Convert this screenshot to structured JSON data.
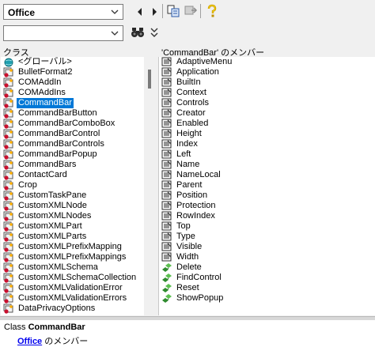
{
  "toolbar1": {
    "library_value": "Office",
    "buttons": [
      "back-icon",
      "forward-icon",
      "copy-to-clipboard-icon",
      "view-definition-icon",
      "help-icon"
    ]
  },
  "toolbar2": {
    "search_value": "",
    "buttons": [
      "binoculars-icon",
      "toggle-search-results-icon"
    ]
  },
  "class_pane": {
    "header": "クラス",
    "selected_index": 4,
    "items": [
      {
        "label": "<グローバル>",
        "icon": "globals-icon"
      },
      {
        "label": "BulletFormat2",
        "icon": "class-icon"
      },
      {
        "label": "COMAddIn",
        "icon": "class-icon"
      },
      {
        "label": "COMAddIns",
        "icon": "class-icon"
      },
      {
        "label": "CommandBar",
        "icon": "class-icon"
      },
      {
        "label": "CommandBarButton",
        "icon": "class-icon"
      },
      {
        "label": "CommandBarComboBox",
        "icon": "class-icon"
      },
      {
        "label": "CommandBarControl",
        "icon": "class-icon"
      },
      {
        "label": "CommandBarControls",
        "icon": "class-icon"
      },
      {
        "label": "CommandBarPopup",
        "icon": "class-icon"
      },
      {
        "label": "CommandBars",
        "icon": "class-icon"
      },
      {
        "label": "ContactCard",
        "icon": "class-icon"
      },
      {
        "label": "Crop",
        "icon": "class-icon"
      },
      {
        "label": "CustomTaskPane",
        "icon": "class-icon"
      },
      {
        "label": "CustomXMLNode",
        "icon": "class-icon"
      },
      {
        "label": "CustomXMLNodes",
        "icon": "class-icon"
      },
      {
        "label": "CustomXMLPart",
        "icon": "class-icon"
      },
      {
        "label": "CustomXMLParts",
        "icon": "class-icon"
      },
      {
        "label": "CustomXMLPrefixMapping",
        "icon": "class-icon"
      },
      {
        "label": "CustomXMLPrefixMappings",
        "icon": "class-icon"
      },
      {
        "label": "CustomXMLSchema",
        "icon": "class-icon"
      },
      {
        "label": "CustomXMLSchemaCollection",
        "icon": "class-icon"
      },
      {
        "label": "CustomXMLValidationError",
        "icon": "class-icon"
      },
      {
        "label": "CustomXMLValidationErrors",
        "icon": "class-icon"
      },
      {
        "label": "DataPrivacyOptions",
        "icon": "class-icon"
      }
    ]
  },
  "member_pane": {
    "header": "'CommandBar' のメンバー",
    "items": [
      {
        "label": "AdaptiveMenu",
        "icon": "property-icon"
      },
      {
        "label": "Application",
        "icon": "property-icon"
      },
      {
        "label": "BuiltIn",
        "icon": "property-icon"
      },
      {
        "label": "Context",
        "icon": "property-icon"
      },
      {
        "label": "Controls",
        "icon": "property-icon"
      },
      {
        "label": "Creator",
        "icon": "property-icon"
      },
      {
        "label": "Enabled",
        "icon": "property-icon"
      },
      {
        "label": "Height",
        "icon": "property-icon"
      },
      {
        "label": "Index",
        "icon": "property-icon"
      },
      {
        "label": "Left",
        "icon": "property-icon"
      },
      {
        "label": "Name",
        "icon": "property-icon"
      },
      {
        "label": "NameLocal",
        "icon": "property-icon"
      },
      {
        "label": "Parent",
        "icon": "property-icon"
      },
      {
        "label": "Position",
        "icon": "property-icon"
      },
      {
        "label": "Protection",
        "icon": "property-icon"
      },
      {
        "label": "RowIndex",
        "icon": "property-icon"
      },
      {
        "label": "Top",
        "icon": "property-icon"
      },
      {
        "label": "Type",
        "icon": "property-icon"
      },
      {
        "label": "Visible",
        "icon": "property-icon"
      },
      {
        "label": "Width",
        "icon": "property-icon"
      },
      {
        "label": "Delete",
        "icon": "method-icon"
      },
      {
        "label": "FindControl",
        "icon": "method-icon"
      },
      {
        "label": "Reset",
        "icon": "method-icon"
      },
      {
        "label": "ShowPopup",
        "icon": "method-icon"
      }
    ]
  },
  "details": {
    "line1_prefix": "Class",
    "class_name": "CommandBar",
    "link": "Office",
    "line2_suffix": "のメンバー"
  },
  "colors": {
    "selection": "#0078d7",
    "link": "#0000ee",
    "property_icon": "#2a2a2a",
    "method_icon": "#2e8b2e",
    "class_icon": "#c8102e"
  }
}
